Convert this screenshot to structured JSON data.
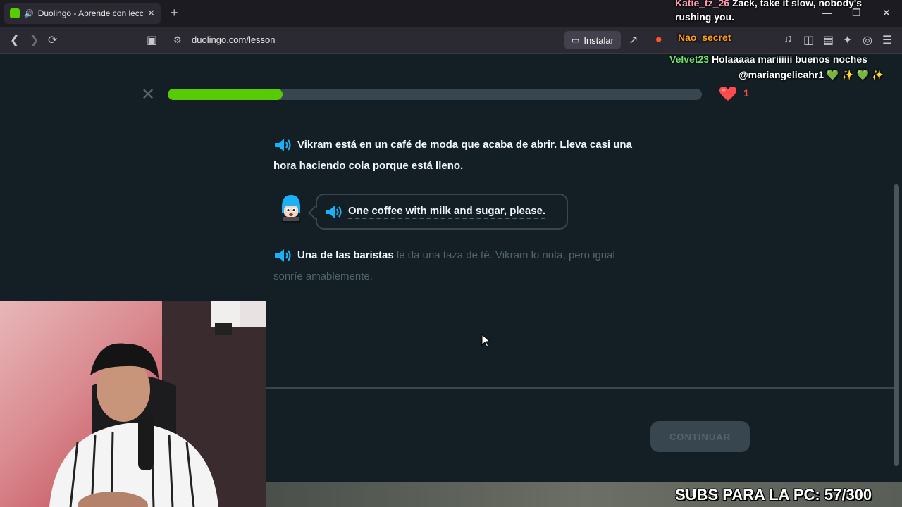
{
  "browser": {
    "tab_title": "Duolingo - Aprende con lecciones",
    "tab_audio_icon": "speaker-icon",
    "new_tab": "+",
    "url": "duolingo.com/lesson",
    "install_label": "Instalar",
    "window_controls": [
      "—",
      "❐",
      "✕"
    ]
  },
  "lesson": {
    "progress_fraction": 0.215,
    "hearts": "1",
    "paragraph1": "Vikram está en un café de moda que acaba de abrir. Lleva casi una hora haciendo cola porque está lleno.",
    "bubble_text": "One coffee with milk and sugar, please.",
    "paragraph2_bold": "Una de las baristas",
    "paragraph2_dim": " le da una taza de té. Vikram lo nota, pero igual sonríe amablemente.",
    "continue_label": "CONTINUAR"
  },
  "stream": {
    "chat1_name": "Katie_tz_26",
    "chat1_text": "Zack, take it slow, nobody's rushing you.",
    "chat2_name": "Nao_secret",
    "chat3_name": "Velvet23",
    "chat3_text": "Holaaaaa mariiiiii buenos noches",
    "chat3_mention": "@mariangelicahr1 💚 ✨ 💚 ✨",
    "subs_goal": "SUBS PARA LA PC: 57/300"
  },
  "colors": {
    "accent": "#58cc02",
    "background": "#131f24",
    "heart": "#ff4b4b"
  }
}
